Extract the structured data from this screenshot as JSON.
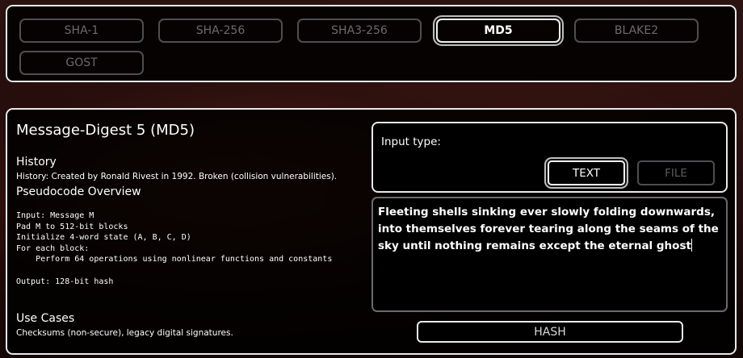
{
  "algorithms": [
    {
      "label": "SHA-1",
      "active": false
    },
    {
      "label": "SHA-256",
      "active": false
    },
    {
      "label": "SHA3-256",
      "active": false
    },
    {
      "label": "MD5",
      "active": true
    },
    {
      "label": "BLAKE2",
      "active": false
    },
    {
      "label": "GOST",
      "active": false
    }
  ],
  "info": {
    "title": "Message-Digest 5 (MD5)",
    "history_heading": "History",
    "history_text": "History: Created by Ronald Rivest in 1992. Broken (collision vulnerabilities).",
    "pseudocode_heading": "Pseudocode Overview",
    "pseudocode": "Input: Message M\nPad M to 512-bit blocks\nInitialize 4-word state (A, B, C, D)\nFor each block:\n    Perform 64 operations using nonlinear functions and constants\n\nOutput: 128-bit hash",
    "use_cases_heading": "Use Cases",
    "use_cases_text": "Checksums (non-secure), legacy digital signatures."
  },
  "input_type": {
    "label": "Input type:",
    "text_button": "TEXT",
    "file_button": "FILE"
  },
  "text_input": {
    "value": "Fleeting shells sinking ever slowly folding downwards, into themselves forever tearing along the seams of the sky until nothing remains except the eternal ghost"
  },
  "hash_button": "HASH",
  "colors": {
    "panel_border": "#e9e9e9",
    "inactive_border": "#4e4e52",
    "inactive_text": "#6a6a70"
  }
}
